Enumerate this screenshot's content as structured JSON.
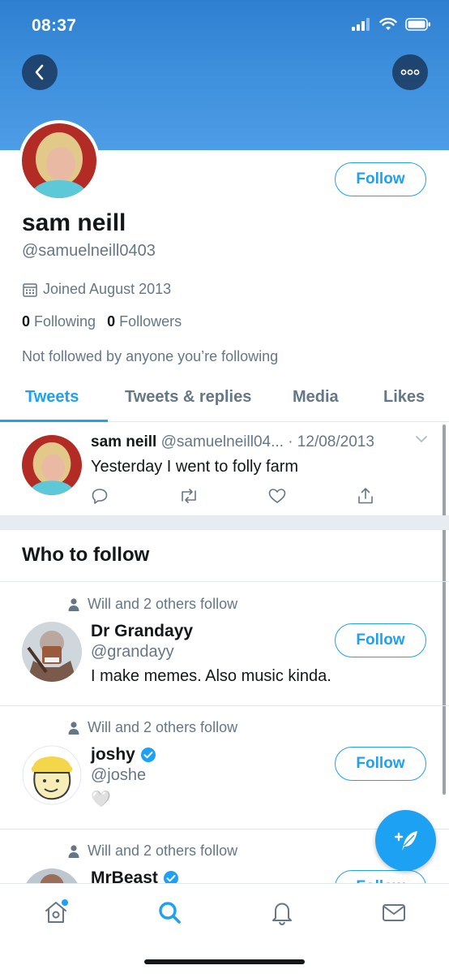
{
  "status_bar": {
    "time": "08:37"
  },
  "profile": {
    "name": "sam neill",
    "handle": "@samuelneill0403",
    "joined": "Joined August 2013",
    "following_count": "0",
    "following_label": "Following",
    "followers_count": "0",
    "followers_label": "Followers",
    "not_followed_text": "Not followed by anyone you’re following",
    "follow_label": "Follow"
  },
  "tabs": [
    {
      "label": "Tweets",
      "active": true
    },
    {
      "label": "Tweets & replies",
      "active": false
    },
    {
      "label": "Media",
      "active": false
    },
    {
      "label": "Likes",
      "active": false
    }
  ],
  "tweet": {
    "name": "sam neill",
    "handle": "@samuelneill04...",
    "date": "· 12/08/2013",
    "text": "Yesterday I went to folly farm"
  },
  "who_to_follow": {
    "title": "Who to follow",
    "items": [
      {
        "social": "Will and 2 others follow",
        "name": "Dr Grandayy",
        "handle": "@grandayy",
        "bio": "I make memes. Also music kinda.",
        "verified": false,
        "follow_label": "Follow"
      },
      {
        "social": "Will and 2 others follow",
        "name": "joshy",
        "handle": "@joshe",
        "bio": "🤍",
        "verified": true,
        "follow_label": "Follow"
      },
      {
        "social": "Will and 2 others follow",
        "name": "MrBeast",
        "handle": "",
        "bio": "",
        "verified": true,
        "follow_label": "Follow"
      }
    ]
  },
  "colors": {
    "accent": "#1da1f2",
    "banner": "#3d8fdc",
    "text": "#14171a",
    "muted": "#657786"
  }
}
